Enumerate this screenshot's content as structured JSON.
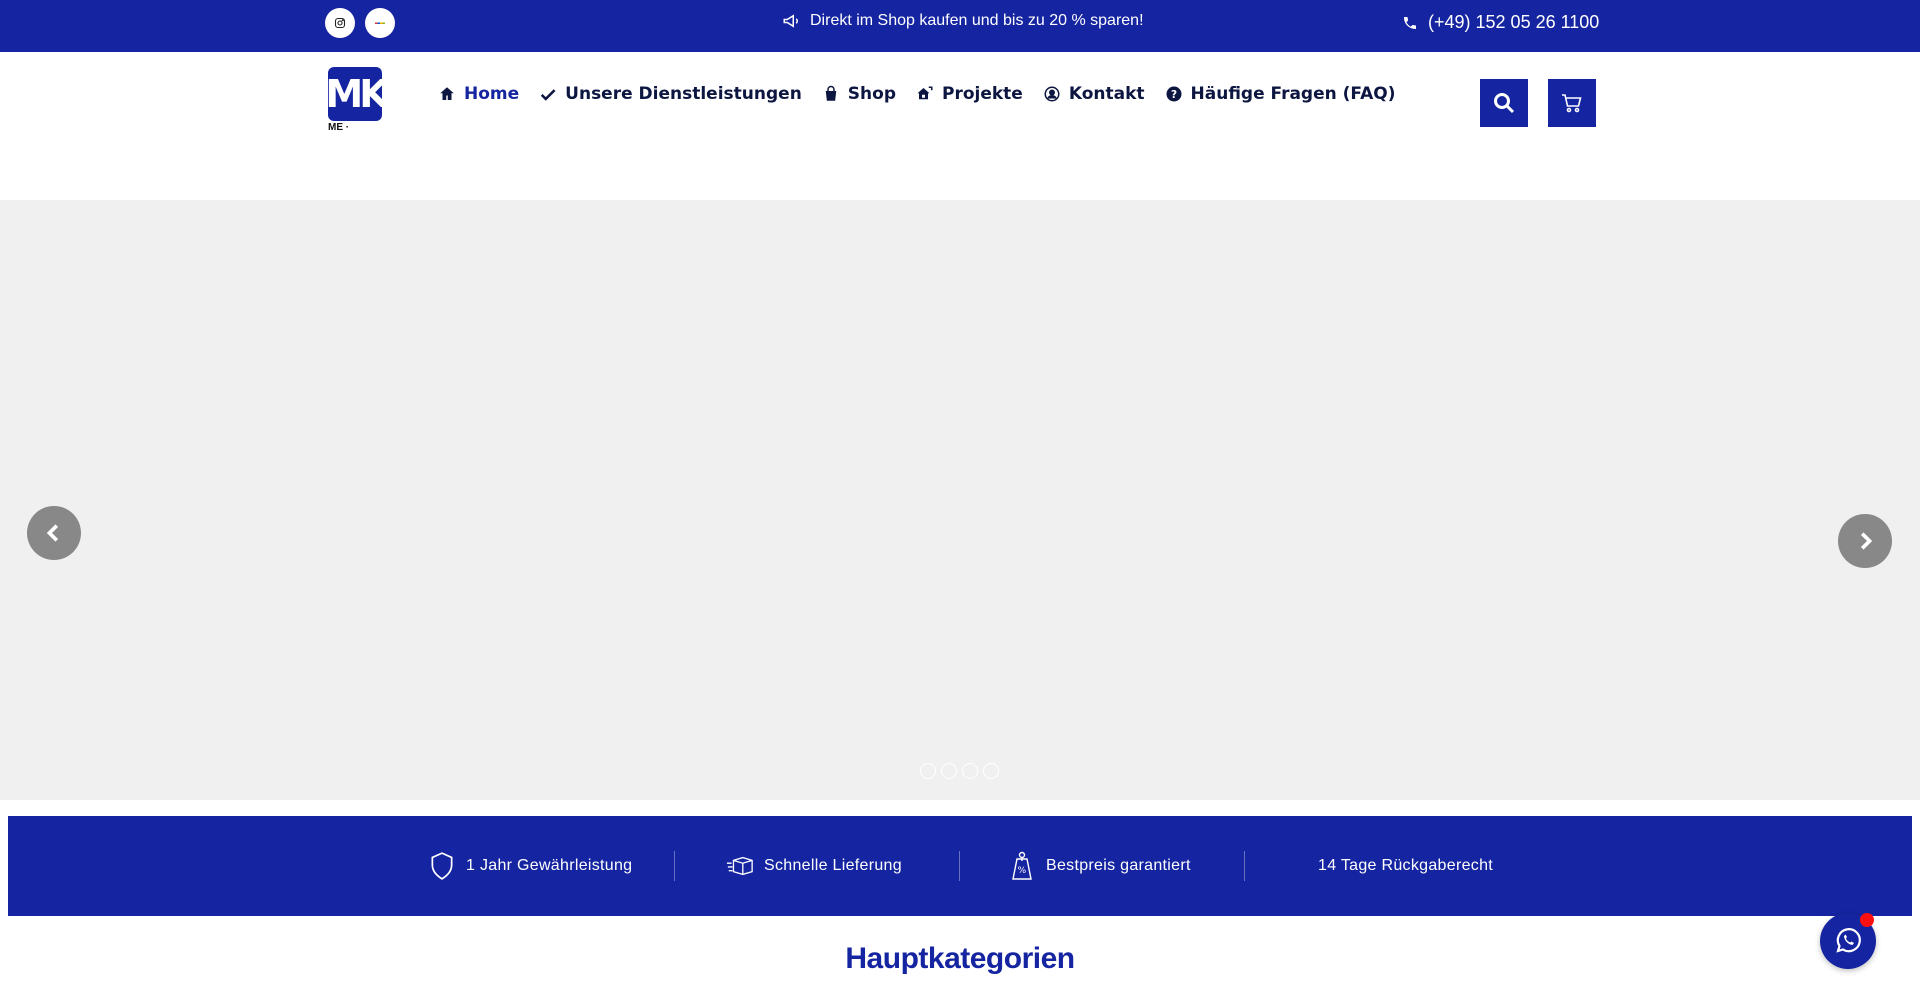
{
  "topbar": {
    "social": [
      {
        "icon": "instagram-icon"
      },
      {
        "icon": "ebay-icon"
      }
    ],
    "promo_text": "Direkt im Shop kaufen und bis zu 20 % sparen!",
    "phone_text": "(+49) 152 05 26 1100"
  },
  "header": {
    "logo_text": "MK",
    "logo_subtext": "ME ·",
    "nav": [
      {
        "label": "Home",
        "icon": "home-icon",
        "active": true
      },
      {
        "label": "Unsere Dienstleistungen",
        "icon": "checkmark-icon"
      },
      {
        "label": "Shop",
        "icon": "shopping-bag-icon"
      },
      {
        "label": "Projekte",
        "icon": "house-tool-icon"
      },
      {
        "label": "Kontakt",
        "icon": "user-circle-icon"
      },
      {
        "label": "Häufige Fragen (FAQ)",
        "icon": "question-circle-icon"
      }
    ],
    "search_icon": "search-icon",
    "cart_icon": "cart-icon"
  },
  "slider": {
    "prev_icon": "chevron-left-icon",
    "next_icon": "chevron-right-icon",
    "dot_count": 4
  },
  "features": [
    {
      "label": "1 Jahr Gewährleistung",
      "icon": "shield-icon"
    },
    {
      "label": "Schnelle Lieferung",
      "icon": "delivery-box-icon"
    },
    {
      "label": "Bestpreis garantiert",
      "icon": "price-tag-icon"
    },
    {
      "label": "14 Tage Rückgaberecht",
      "icon": ""
    }
  ],
  "main": {
    "section_title": "Hauptkategorien"
  },
  "whatsapp": {
    "icon": "whatsapp-icon"
  },
  "colors": {
    "primary": "#1524a0",
    "nav_text": "#0c1640",
    "slider_bg": "#f0f0f0",
    "badge": "#ff1010"
  }
}
